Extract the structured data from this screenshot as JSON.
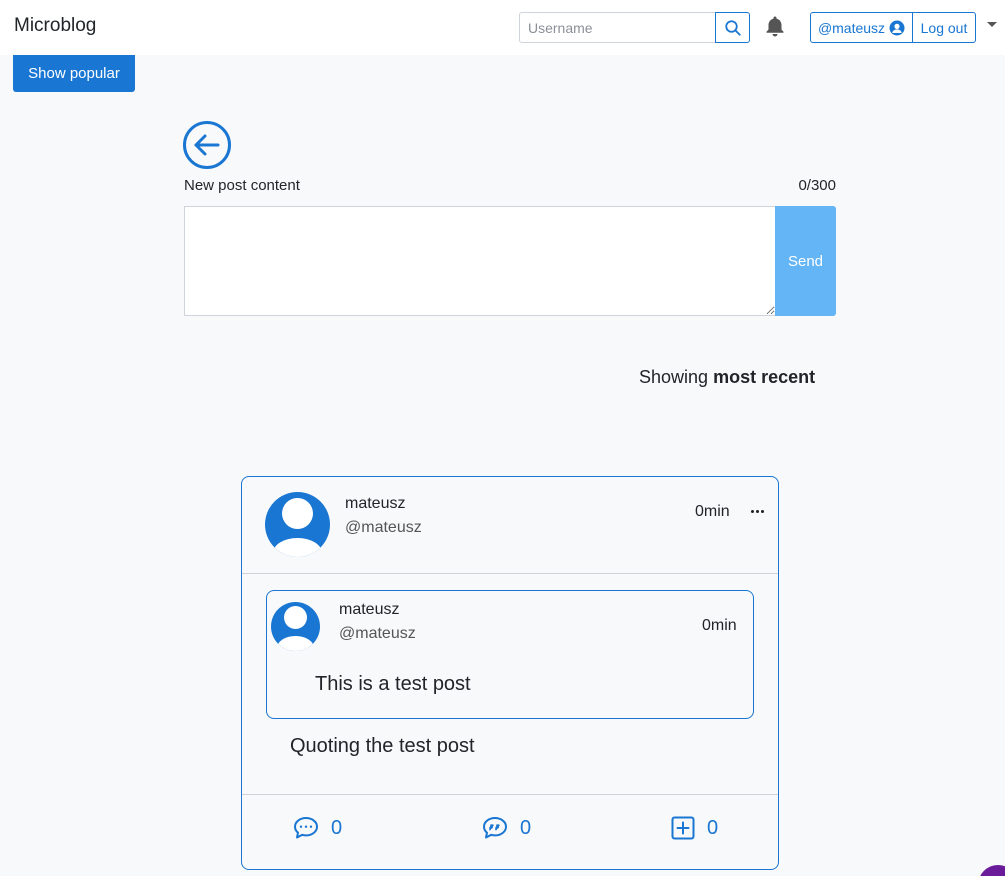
{
  "app": {
    "brand": "Microblog"
  },
  "header": {
    "search_placeholder": "Username",
    "user_button_label": "@mateusz",
    "logout_label": "Log out"
  },
  "sidebar": {
    "show_popular_label": "Show popular"
  },
  "composer": {
    "label": "New post content",
    "counter": "0/300",
    "value": "",
    "send_label": "Send"
  },
  "feed": {
    "showing_prefix": "Showing",
    "showing_mode": "most recent"
  },
  "post": {
    "name": "mateusz",
    "handle": "@mateusz",
    "time": "0min",
    "text": "Quoting the test post",
    "quote": {
      "name": "mateusz",
      "handle": "@mateusz",
      "time": "0min",
      "text": "This is a test post"
    },
    "actions": {
      "comments": "0",
      "quotes": "0",
      "reposts": "0"
    }
  },
  "icons": {
    "search": "search-icon",
    "bell": "bell-icon",
    "user": "user-icon",
    "back": "arrow-left-circle-icon",
    "more": "ellipsis-icon",
    "comment": "comment-dots-icon",
    "quote": "quote-bubble-icon",
    "repost": "plus-square-icon"
  },
  "colors": {
    "accent": "#1976d2",
    "send_disabled": "#64b5f6"
  }
}
